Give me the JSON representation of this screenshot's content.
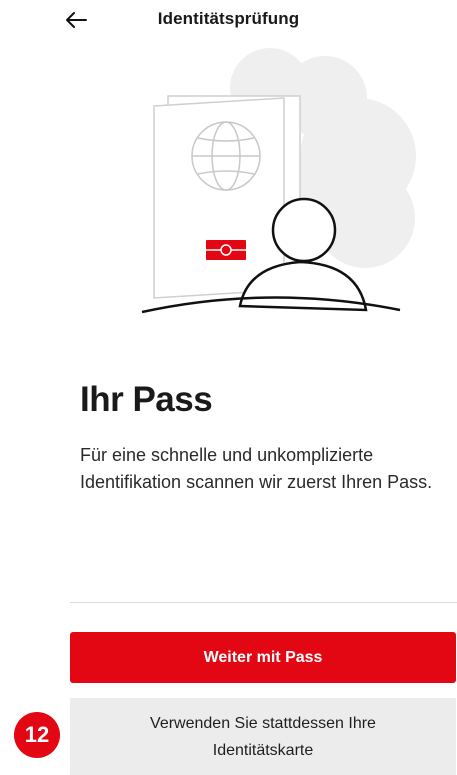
{
  "header": {
    "title": "Identitätsprüfung",
    "back_icon": "arrow-left-icon"
  },
  "illustration": {
    "name": "passport-with-person",
    "accent_color": "#e30613"
  },
  "content": {
    "heading": "Ihr Pass",
    "description": "Für eine schnelle und unkomplizierte Identifikation scannen wir zuerst Ihren Pass."
  },
  "actions": {
    "primary_label": "Weiter mit Pass",
    "secondary_label": "Verwenden Sie stattdessen Ihre Identitätskarte"
  },
  "badge": {
    "number": "12"
  },
  "colors": {
    "brand": "#e30613",
    "secondary_bg": "#ececec"
  }
}
